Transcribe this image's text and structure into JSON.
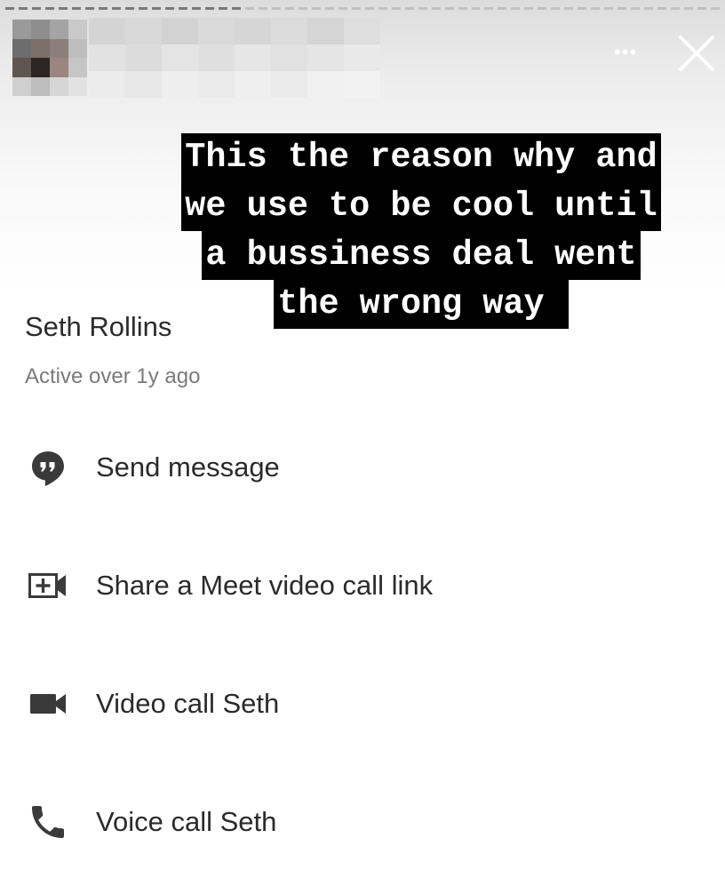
{
  "story": {
    "caption_lines": [
      "This the reason why and",
      "we use to be cool until",
      "a bussiness deal went",
      "the wrong way "
    ],
    "more_icon": "more-dots-icon",
    "close_icon": "close-icon"
  },
  "contact": {
    "name": "Seth Rollins",
    "status": "Active over 1y ago"
  },
  "actions": [
    {
      "label": "Send message",
      "icon": "message-bubble-icon"
    },
    {
      "label": "Share a Meet video call link",
      "icon": "meet-add-icon"
    },
    {
      "label": "Video call Seth",
      "icon": "video-camera-icon"
    },
    {
      "label": "Voice call Seth",
      "icon": "phone-icon"
    }
  ],
  "colors": {
    "icon": "#3a3a3a",
    "caption_bg": "#000000",
    "caption_text": "#ffffff"
  }
}
